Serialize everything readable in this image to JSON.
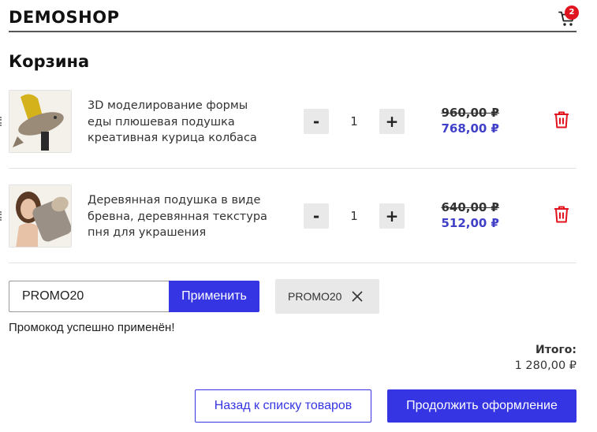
{
  "header": {
    "logo": "DEMOSHOP",
    "cart_count": "2",
    "cart_icon": "shopping-cart-icon"
  },
  "page_title": "Корзина",
  "items": [
    {
      "name": "3D моделирование формы еды плюшевая подушка креативная курица колбаса",
      "quantity": "1",
      "minus_label": "-",
      "plus_label": "+",
      "old_price": "960,00 ₽",
      "new_price": "768,00 ₽",
      "delete_icon": "trash-icon"
    },
    {
      "name": "Деревянная подушка в виде бревна, деревянная текстура пня для украшения",
      "quantity": "1",
      "minus_label": "-",
      "plus_label": "+",
      "old_price": "640,00 ₽",
      "new_price": "512,00 ₽",
      "delete_icon": "trash-icon"
    }
  ],
  "promo": {
    "input_value": "PROMO20",
    "apply_label": "Применить",
    "applied_code": "PROMO20",
    "remove_icon": "close-icon",
    "success_message": "Промокод успешно применён!"
  },
  "total": {
    "label": "Итого:",
    "value": "1 280,00 ₽"
  },
  "actions": {
    "back_label": "Назад к списку товаров",
    "continue_label": "Продолжить оформление"
  },
  "colors": {
    "accent": "#3535e3",
    "discount_price": "#4040c8",
    "delete": "#e0141e",
    "badge": "#e0141e"
  }
}
